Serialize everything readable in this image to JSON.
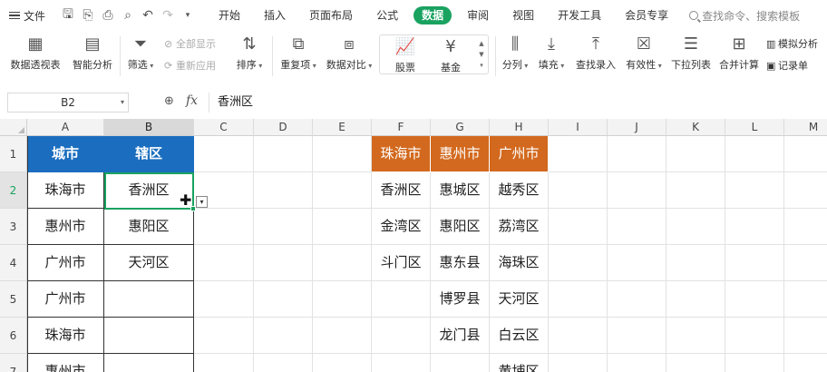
{
  "menubar": {
    "file_label": "文件",
    "tabs": [
      "开始",
      "插入",
      "页面布局",
      "公式",
      "数据",
      "审阅",
      "视图",
      "开发工具",
      "会员专享"
    ],
    "active_tab": "数据",
    "search_label": "查找命令、搜索模板"
  },
  "ribbon": {
    "pivot": "数据透视表",
    "smart": "智能分析",
    "filter": "筛选",
    "show_all": "全部显示",
    "reapply": "重新应用",
    "sort": "排序",
    "dup": "重复项",
    "compare": "数据对比",
    "stock": "股票",
    "fund": "基金",
    "split": "分列",
    "fill": "填充",
    "find_entry": "查找录入",
    "validity": "有效性",
    "dropdown": "下拉列表",
    "merge_calc": "合并计算",
    "sim_analysis": "模拟分析",
    "record": "记录单"
  },
  "formula_bar": {
    "cell_ref": "B2",
    "fx": "fx",
    "content": "香洲区"
  },
  "sheet": {
    "columns": [
      "A",
      "B",
      "C",
      "D",
      "E",
      "F",
      "G",
      "H",
      "I",
      "J",
      "K",
      "L",
      "M"
    ],
    "selected_column": "B",
    "rows": [
      "1",
      "2",
      "3",
      "4",
      "5",
      "6",
      "7"
    ],
    "selected_row": "2",
    "cells": {
      "A1": "城市",
      "B1": "辖区",
      "A2": "珠海市",
      "B2": "香洲区",
      "A3": "惠州市",
      "B3": "惠阳区",
      "A4": "广州市",
      "B4": "天河区",
      "A5": "广州市",
      "A6": "珠海市",
      "A7": "惠州市",
      "F1": "珠海市",
      "G1": "惠州市",
      "H1": "广州市",
      "F2": "香洲区",
      "G2": "惠城区",
      "H2": "越秀区",
      "F3": "金湾区",
      "G3": "惠阳区",
      "H3": "荔湾区",
      "F4": "斗门区",
      "G4": "惠东县",
      "H4": "海珠区",
      "G5": "博罗县",
      "H5": "天河区",
      "G6": "龙门县",
      "H6": "白云区",
      "H7": "黄埔区"
    },
    "colors": {
      "header_blue": "#1b6ebf",
      "header_orange": "#d2691e",
      "selection": "#1aa260"
    }
  }
}
